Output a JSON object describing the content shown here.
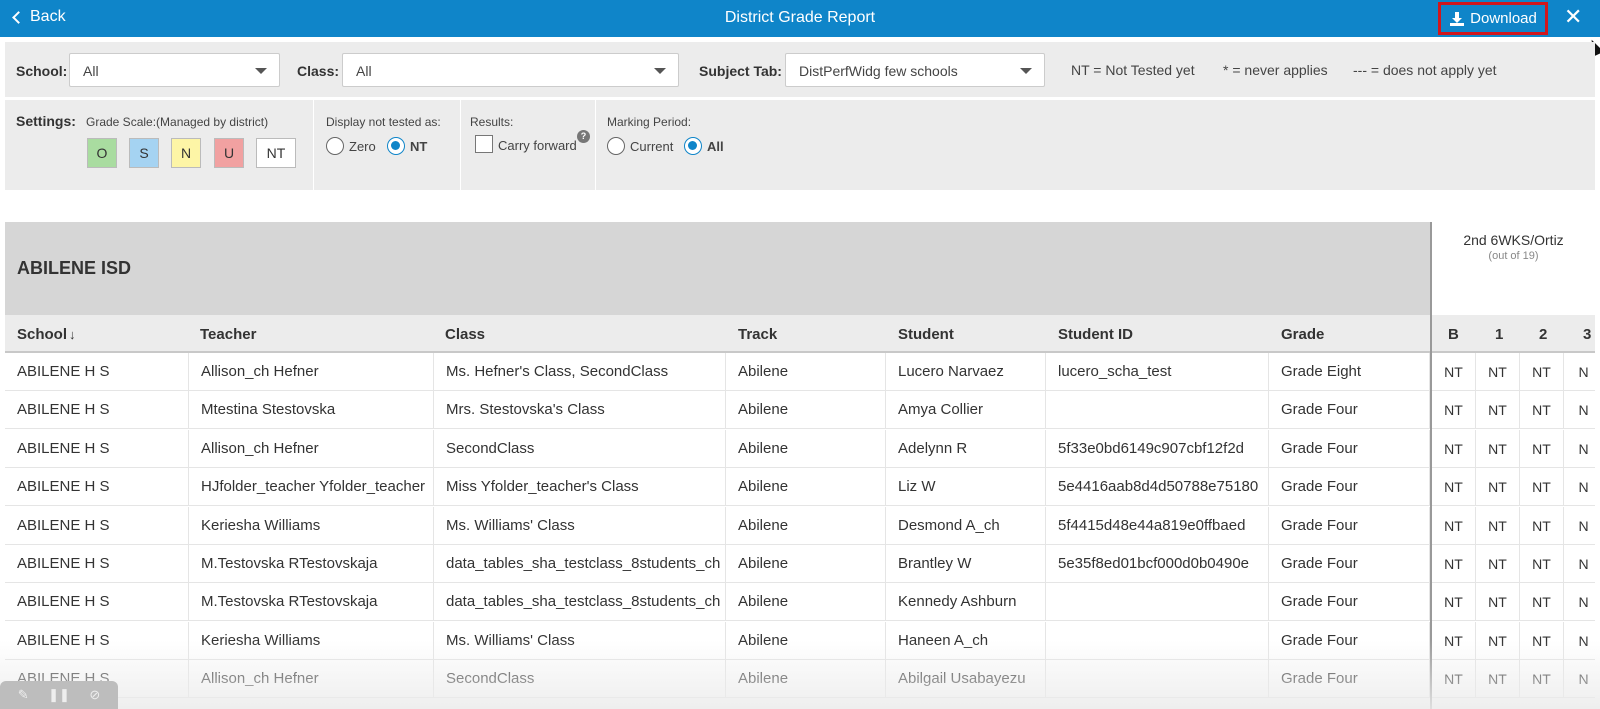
{
  "header": {
    "back_label": "Back",
    "title": "District Grade Report",
    "download_label": "Download",
    "close_glyph": "✕"
  },
  "filters": {
    "school_label": "School:",
    "school_value": "All",
    "class_label": "Class:",
    "class_value": "All",
    "subject_label": "Subject Tab:",
    "subject_value": "DistPerfWidg few schools",
    "legend": [
      "NT = Not Tested yet",
      "* = never applies",
      "--- = does not apply yet"
    ]
  },
  "settings": {
    "label": "Settings:",
    "grade_scale_label": "Grade Scale:(Managed by district)",
    "grade_scale": [
      {
        "label": "O",
        "color": "#a9dca0"
      },
      {
        "label": "S",
        "color": "#a5d3f2"
      },
      {
        "label": "N",
        "color": "#fdf5a6"
      },
      {
        "label": "U",
        "color": "#f1a1a1"
      },
      {
        "label": "NT",
        "color": "#ffffff"
      }
    ],
    "display_label": "Display not tested as:",
    "display_options": [
      "Zero",
      "NT"
    ],
    "display_selected": "NT",
    "results_label": "Results:",
    "carry_forward_label": "Carry forward",
    "carry_forward_checked": false,
    "help_glyph": "?",
    "marking_label": "Marking Period:",
    "marking_options": [
      "Current",
      "All"
    ],
    "marking_selected": "All"
  },
  "table": {
    "district": "ABILENE ISD",
    "period_name": "2nd 6WKS/Ortiz",
    "period_sub": "(out of 19)",
    "sort_arrow": "↓",
    "columns": [
      "School",
      "Teacher",
      "Class",
      "Track",
      "Student",
      "Student ID",
      "Grade"
    ],
    "period_columns": [
      "B",
      "1",
      "2",
      "3"
    ],
    "rows": [
      {
        "school": "ABILENE H S",
        "teacher": "Allison_ch Hefner",
        "class": "Ms. Hefner's Class, SecondClass",
        "track": "Abilene",
        "student": "Lucero Narvaez",
        "student_id": "lucero_scha_test",
        "grade": "Grade Eight",
        "marks": [
          "NT",
          "NT",
          "NT",
          "N"
        ]
      },
      {
        "school": "ABILENE H S",
        "teacher": "Mtestina Stestovska",
        "class": "Mrs. Stestovska's Class",
        "track": "Abilene",
        "student": "Amya Collier",
        "student_id": "",
        "grade": "Grade Four",
        "marks": [
          "NT",
          "NT",
          "NT",
          "N"
        ]
      },
      {
        "school": "ABILENE H S",
        "teacher": "Allison_ch Hefner",
        "class": "SecondClass",
        "track": "Abilene",
        "student": "Adelynn R",
        "student_id": "5f33e0bd6149c907cbf12f2d",
        "grade": "Grade Four",
        "marks": [
          "NT",
          "NT",
          "NT",
          "N"
        ]
      },
      {
        "school": "ABILENE H S",
        "teacher": "HJfolder_teacher Yfolder_teacher",
        "class": "Miss Yfolder_teacher's Class",
        "track": "Abilene",
        "student": "Liz W",
        "student_id": "5e4416aab8d4d50788e75180",
        "grade": "Grade Four",
        "marks": [
          "NT",
          "NT",
          "NT",
          "N"
        ]
      },
      {
        "school": "ABILENE H S",
        "teacher": "Keriesha Williams",
        "class": "Ms. Williams' Class",
        "track": "Abilene",
        "student": "Desmond A_ch",
        "student_id": "5f4415d48e44a819e0ffbaed",
        "grade": "Grade Four",
        "marks": [
          "NT",
          "NT",
          "NT",
          "N"
        ]
      },
      {
        "school": "ABILENE H S",
        "teacher": "M.Testovska RTestovskaja",
        "class": "data_tables_sha_testclass_8students_ch",
        "track": "Abilene",
        "student": "Brantley W",
        "student_id": "5e35f8ed01bcf000d0b0490e",
        "grade": "Grade Four",
        "marks": [
          "NT",
          "NT",
          "NT",
          "N"
        ]
      },
      {
        "school": "ABILENE H S",
        "teacher": "M.Testovska RTestovskaja",
        "class": "data_tables_sha_testclass_8students_ch",
        "track": "Abilene",
        "student": "Kennedy Ashburn",
        "student_id": "",
        "grade": "Grade Four",
        "marks": [
          "NT",
          "NT",
          "NT",
          "N"
        ]
      },
      {
        "school": "ABILENE H S",
        "teacher": "Keriesha Williams",
        "class": "Ms. Williams' Class",
        "track": "Abilene",
        "student": "Haneen A_ch",
        "student_id": "",
        "grade": "Grade Four",
        "marks": [
          "NT",
          "NT",
          "NT",
          "N"
        ]
      },
      {
        "school": "ABILENE H S",
        "teacher": "Allison_ch Hefner",
        "class": "SecondClass",
        "track": "Abilene",
        "student": "Abilgail Usabayezu",
        "student_id": "",
        "grade": "Grade Four",
        "marks": [
          "NT",
          "NT",
          "NT",
          "N"
        ]
      }
    ]
  },
  "recorder": {
    "icons": [
      "edit-icon",
      "pause-icon",
      "stop-icon"
    ]
  }
}
